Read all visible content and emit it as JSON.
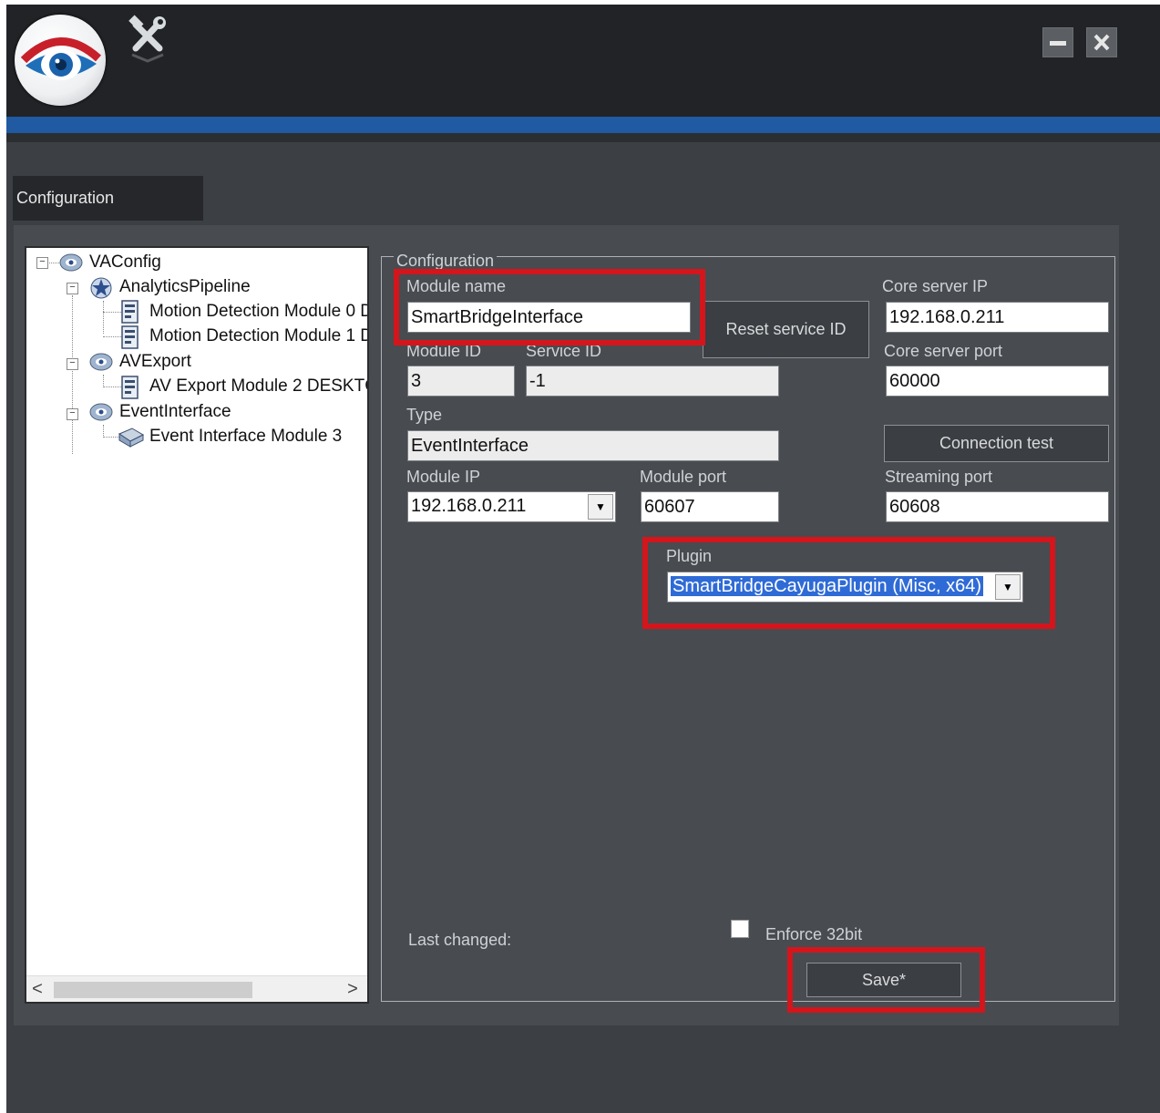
{
  "colors": {
    "titlebar": "#212326",
    "accent_bar": "#1f5aa2",
    "panel": "#484b50",
    "highlight": "#d5151c"
  },
  "window": {
    "minimize_icon": "minimize-icon",
    "close_icon": "close-icon",
    "tools_icon": "wrench-hammer-icon",
    "logo_icon": "eye-logo-icon"
  },
  "tab": {
    "label": "Configuration"
  },
  "tree": {
    "nodes": [
      {
        "label": "VAConfig",
        "icon": "network-eye-icon"
      },
      {
        "label": "AnalyticsPipeline",
        "icon": "pipeline-star-icon"
      },
      {
        "label": "Motion Detection Module 0 D",
        "icon": "module-document-icon"
      },
      {
        "label": "Motion Detection Module 1 D",
        "icon": "module-document-icon"
      },
      {
        "label": "AVExport",
        "icon": "network-eye-icon"
      },
      {
        "label": "AV Export Module 2 DESKTC",
        "icon": "module-document-icon"
      },
      {
        "label": "EventInterface",
        "icon": "network-eye-icon"
      },
      {
        "label": "Event Interface Module 3",
        "icon": "event-interface-icon"
      }
    ],
    "expander_symbol": "−",
    "scroll_left": "<",
    "scroll_right": ">"
  },
  "config": {
    "group_title": "Configuration",
    "module_name_label": "Module name",
    "module_name_value": "SmartBridgeInterface",
    "reset_service_id": "Reset service ID",
    "module_id_label": "Module ID",
    "module_id_value": "3",
    "service_id_label": "Service ID",
    "service_id_value": "-1",
    "type_label": "Type",
    "type_value": "EventInterface",
    "module_ip_label": "Module IP",
    "module_ip_value": "192.168.0.211",
    "module_port_label": "Module port",
    "module_port_value": "60607",
    "core_server_ip_label": "Core server IP",
    "core_server_ip_value": "192.168.0.211",
    "core_server_port_label": "Core server port",
    "core_server_port_value": "60000",
    "connection_test": "Connection test",
    "streaming_port_label": "Streaming port",
    "streaming_port_value": "60608",
    "plugin_label": "Plugin",
    "plugin_value": "SmartBridgeCayugaPlugin (Misc, x64)",
    "last_changed_label": "Last changed:",
    "enforce_32bit_label": "Enforce 32bit",
    "enforce_32bit_checked": false,
    "save_button": "Save*",
    "dropdown_arrow": "▼"
  }
}
